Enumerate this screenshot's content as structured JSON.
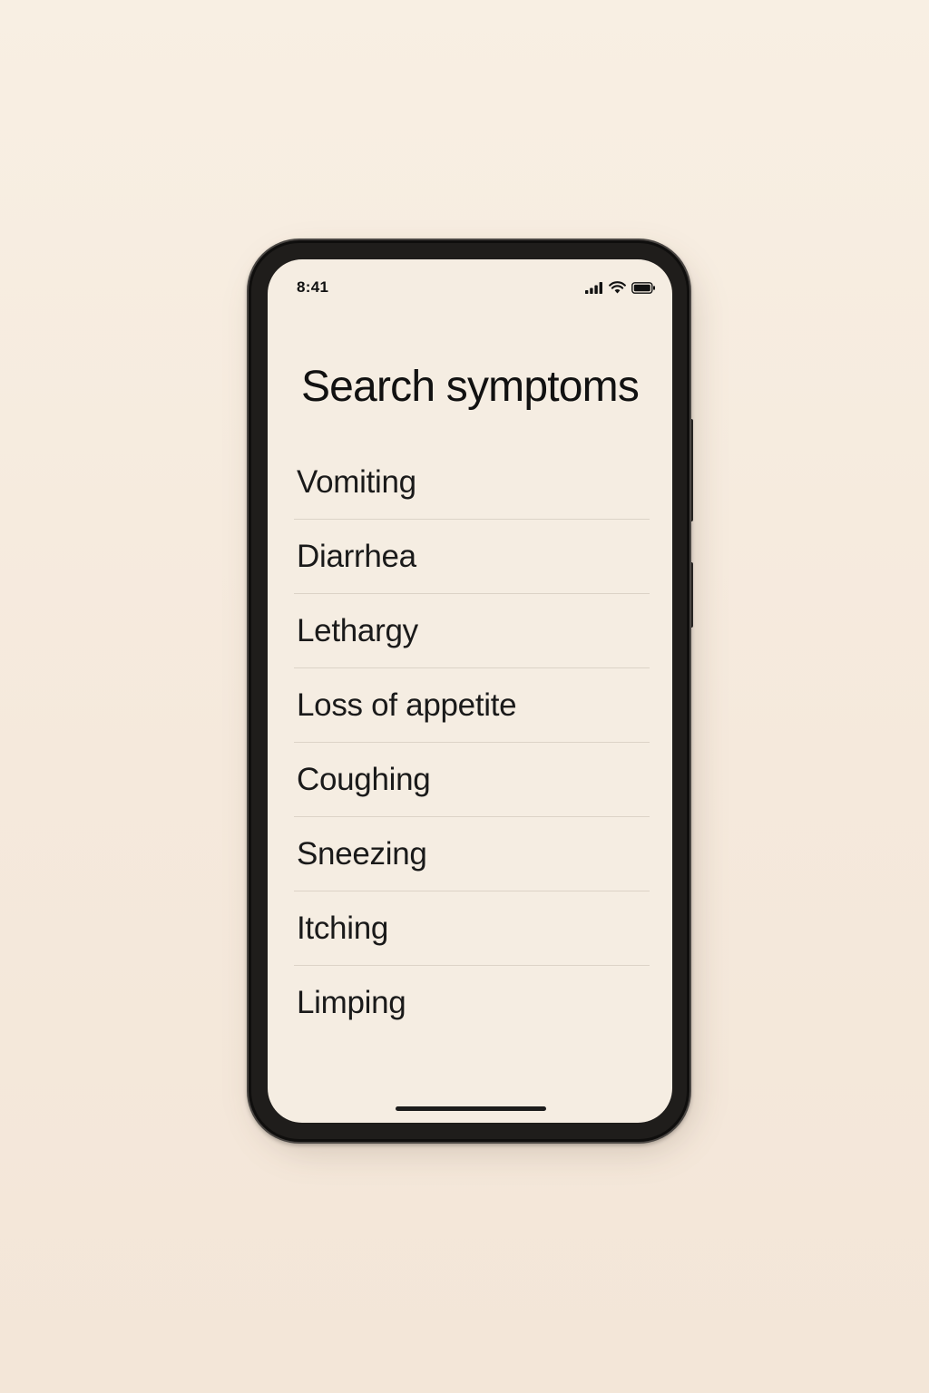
{
  "status_bar": {
    "time": "8:41",
    "icons": [
      "cellular-signal-icon",
      "wifi-icon",
      "battery-icon"
    ]
  },
  "page": {
    "title": "Search symptoms"
  },
  "symptoms": [
    {
      "label": "Vomiting"
    },
    {
      "label": "Diarrhea"
    },
    {
      "label": "Lethargy"
    },
    {
      "label": "Loss of appetite"
    },
    {
      "label": "Coughing"
    },
    {
      "label": "Sneezing"
    },
    {
      "label": "Itching"
    },
    {
      "label": "Limping"
    }
  ],
  "colors": {
    "background": "#f7ede1",
    "screen": "#f5ede2",
    "text": "#111111",
    "divider": "#dcd3c7",
    "phone_frame": "#1f1d1b"
  }
}
